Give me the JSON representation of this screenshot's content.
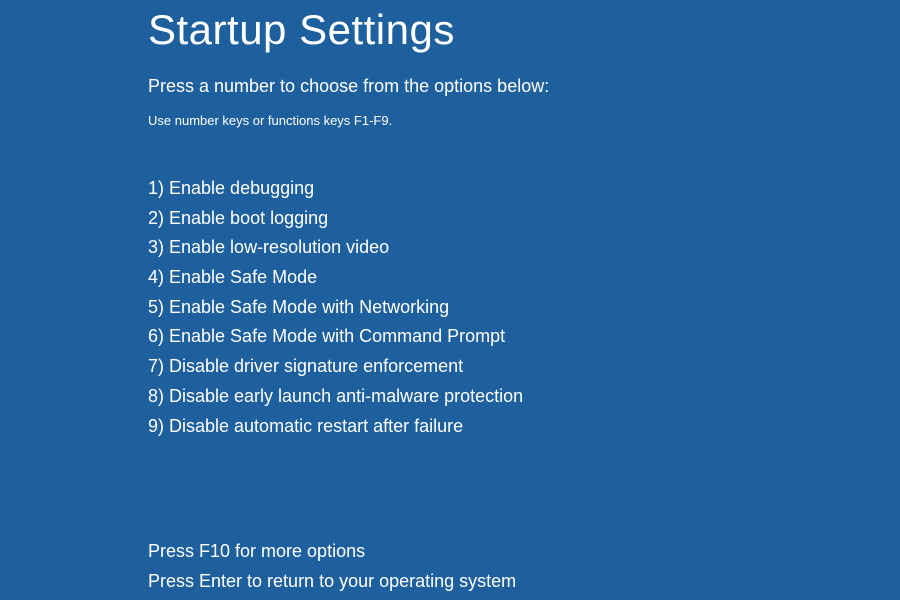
{
  "title": "Startup Settings",
  "instruction": "Press a number to choose from the options below:",
  "hint": "Use number keys or functions keys F1-F9.",
  "options": [
    "1) Enable debugging",
    "2) Enable boot logging",
    "3) Enable low-resolution video",
    "4) Enable Safe Mode",
    "5) Enable Safe Mode with Networking",
    "6) Enable Safe Mode with Command Prompt",
    "7) Disable driver signature enforcement",
    "8) Disable early launch anti-malware protection",
    "9) Disable automatic restart after failure"
  ],
  "footer": {
    "more_options": "Press F10 for more options",
    "return_os": "Press Enter to return to your operating system"
  }
}
